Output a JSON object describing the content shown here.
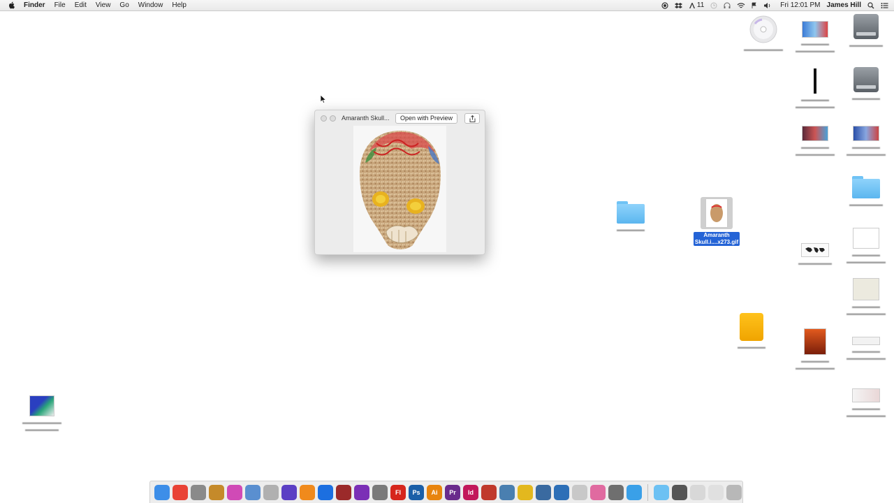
{
  "menubar": {
    "app": "Finder",
    "menus": [
      "File",
      "Edit",
      "View",
      "Go",
      "Window",
      "Help"
    ],
    "adobe_badge": "11",
    "clock": "Fri 12:01 PM",
    "user": "James Hill"
  },
  "quicklook": {
    "title": "Amaranth Skull...",
    "open_button": "Open with Preview"
  },
  "desktop": {
    "selected_file_line1": "Amaranth",
    "selected_file_line2": "Skull.i....x273.gif"
  },
  "dock": {
    "apps": [
      {
        "icon": "finder-icon",
        "label": "",
        "color": "#3d8ee8"
      },
      {
        "icon": "chrome-icon",
        "label": "",
        "color": "#e94235"
      },
      {
        "icon": "preview-icon",
        "label": "",
        "color": "#8a8a8a"
      },
      {
        "icon": "garageband-icon",
        "label": "",
        "color": "#c58a2a"
      },
      {
        "icon": "itunes-icon",
        "label": "",
        "color": "#d04ab6"
      },
      {
        "icon": "mail-icon",
        "label": "",
        "color": "#5a8fd0"
      },
      {
        "icon": "pencil-icon",
        "label": "",
        "color": "#b0b0b0"
      },
      {
        "icon": "imovie-icon",
        "label": "",
        "color": "#5b3fc4"
      },
      {
        "icon": "vlc-icon",
        "label": "",
        "color": "#f08a1c"
      },
      {
        "icon": "activity-icon",
        "label": "",
        "color": "#1c6fe0"
      },
      {
        "icon": "photobooth-icon",
        "label": "",
        "color": "#9b2a2a"
      },
      {
        "icon": "toast-icon",
        "label": "",
        "color": "#7b2fb6"
      },
      {
        "icon": "safari-icon",
        "label": "",
        "color": "#7a7a7a"
      },
      {
        "icon": "flash-icon",
        "label": "Fl",
        "color": "#d6261c"
      },
      {
        "icon": "photoshop-icon",
        "label": "Ps",
        "color": "#1b5fa8"
      },
      {
        "icon": "illustrator-icon",
        "label": "Ai",
        "color": "#e8840e"
      },
      {
        "icon": "premiere-icon",
        "label": "Pr",
        "color": "#6a2b8c"
      },
      {
        "icon": "indesign-icon",
        "label": "Id",
        "color": "#c2185b"
      },
      {
        "icon": "media-icon",
        "label": "",
        "color": "#c0392b"
      },
      {
        "icon": "network-icon",
        "label": "",
        "color": "#4a7fb0"
      },
      {
        "icon": "radiation-icon",
        "label": "",
        "color": "#e3b81e"
      },
      {
        "icon": "quicktime-icon",
        "label": "",
        "color": "#3a6aa0"
      },
      {
        "icon": "globe-icon",
        "label": "",
        "color": "#2d6fb7"
      },
      {
        "icon": "feather-icon",
        "label": "",
        "color": "#c8c8c8"
      },
      {
        "icon": "photos-icon",
        "label": "",
        "color": "#e06aa0"
      },
      {
        "icon": "settings-icon",
        "label": "",
        "color": "#6f6f6f"
      },
      {
        "icon": "messages-icon",
        "label": "",
        "color": "#3aa0e8"
      }
    ],
    "right": [
      {
        "icon": "folder-icon",
        "color": "#6cc1f3"
      },
      {
        "icon": "window-icon",
        "color": "#555555"
      },
      {
        "icon": "document-icon",
        "color": "#d8d8d8"
      },
      {
        "icon": "document2-icon",
        "color": "#e0e0e0"
      },
      {
        "icon": "trash-icon",
        "color": "#b8b8b8"
      }
    ]
  }
}
